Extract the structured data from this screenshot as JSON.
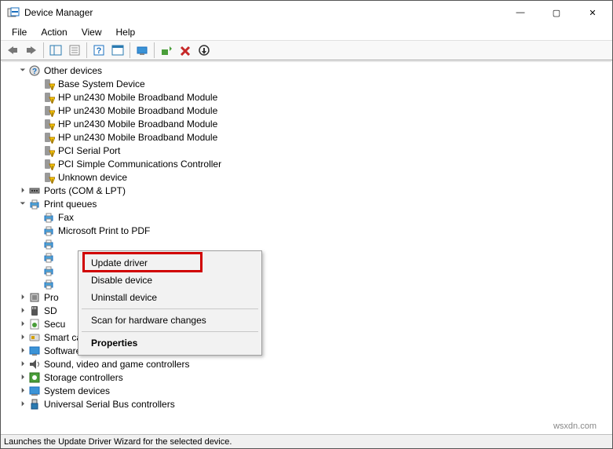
{
  "window": {
    "title": "Device Manager",
    "controls": {
      "min": "—",
      "max": "▢",
      "close": "✕"
    }
  },
  "menubar": {
    "items": [
      "File",
      "Action",
      "View",
      "Help"
    ]
  },
  "toolbar": {
    "items": [
      {
        "name": "nav-back"
      },
      {
        "name": "nav-forward"
      },
      {
        "sep": true
      },
      {
        "name": "show-hide-tree"
      },
      {
        "name": "properties"
      },
      {
        "sep": true
      },
      {
        "name": "help"
      },
      {
        "name": "action"
      },
      {
        "sep": true
      },
      {
        "name": "scan-hardware"
      },
      {
        "sep": true
      },
      {
        "name": "update-driver"
      },
      {
        "name": "uninstall-device"
      },
      {
        "name": "disable-device"
      }
    ]
  },
  "tree": [
    {
      "level": 0,
      "label": "Other devices",
      "icon": "other",
      "expanded": true
    },
    {
      "level": 1,
      "label": "Base System Device",
      "icon": "warn"
    },
    {
      "level": 1,
      "label": "HP un2430 Mobile Broadband Module",
      "icon": "warn"
    },
    {
      "level": 1,
      "label": "HP un2430 Mobile Broadband Module",
      "icon": "warn"
    },
    {
      "level": 1,
      "label": "HP un2430 Mobile Broadband Module",
      "icon": "warn"
    },
    {
      "level": 1,
      "label": "HP un2430 Mobile Broadband Module",
      "icon": "warn"
    },
    {
      "level": 1,
      "label": "PCI Serial Port",
      "icon": "warn"
    },
    {
      "level": 1,
      "label": "PCI Simple Communications Controller",
      "icon": "warn"
    },
    {
      "level": 1,
      "label": "Unknown device",
      "icon": "warn"
    },
    {
      "level": 0,
      "label": "Ports (COM & LPT)",
      "icon": "port",
      "expanded": false,
      "haschildren": true
    },
    {
      "level": 0,
      "label": "Print queues",
      "icon": "printer",
      "expanded": true
    },
    {
      "level": 1,
      "label": "Fax",
      "icon": "printer"
    },
    {
      "level": 1,
      "label": "Microsoft Print to PDF",
      "icon": "printer"
    },
    {
      "level": 1,
      "label": "",
      "icon": "printer",
      "hidden_label": true
    },
    {
      "level": 1,
      "label": "",
      "icon": "printer",
      "hidden_label": true
    },
    {
      "level": 1,
      "label": "",
      "icon": "printer",
      "hidden_label": true
    },
    {
      "level": 1,
      "label": "",
      "icon": "printer",
      "hidden_label": true
    },
    {
      "level": 0,
      "label": "Pro",
      "icon": "cpu",
      "expanded": false,
      "haschildren": true,
      "truncated": true
    },
    {
      "level": 0,
      "label": "SD ",
      "icon": "sd",
      "expanded": false,
      "haschildren": true,
      "truncated": true
    },
    {
      "level": 0,
      "label": "Secu",
      "icon": "security",
      "expanded": false,
      "haschildren": true,
      "truncated": true
    },
    {
      "level": 0,
      "label": "Smart card readers",
      "icon": "smartcard",
      "expanded": false,
      "haschildren": true
    },
    {
      "level": 0,
      "label": "Software devices",
      "icon": "software",
      "expanded": false,
      "haschildren": true
    },
    {
      "level": 0,
      "label": "Sound, video and game controllers",
      "icon": "sound",
      "expanded": false,
      "haschildren": true
    },
    {
      "level": 0,
      "label": "Storage controllers",
      "icon": "storage",
      "expanded": false,
      "haschildren": true
    },
    {
      "level": 0,
      "label": "System devices",
      "icon": "system",
      "expanded": false,
      "haschildren": true
    },
    {
      "level": 0,
      "label": "Universal Serial Bus controllers",
      "icon": "usb",
      "expanded": false,
      "haschildren": true
    }
  ],
  "context_menu": {
    "items": [
      {
        "label": "Update driver",
        "highlighted": true
      },
      {
        "label": "Disable device"
      },
      {
        "label": "Uninstall device"
      },
      {
        "sep": true
      },
      {
        "label": "Scan for hardware changes"
      },
      {
        "sep": true
      },
      {
        "label": "Properties",
        "bold": true
      }
    ]
  },
  "statusbar": {
    "text": "Launches the Update Driver Wizard for the selected device."
  },
  "watermark": "wsxdn.com"
}
